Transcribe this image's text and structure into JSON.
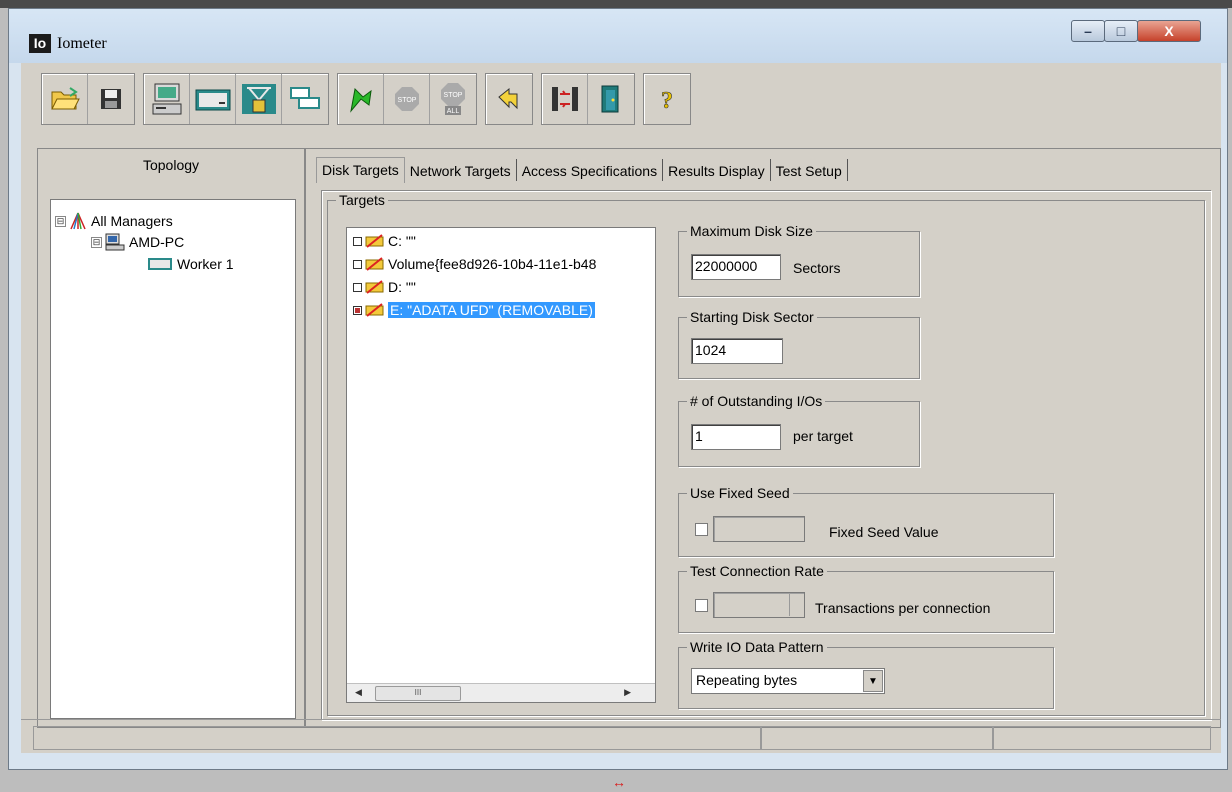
{
  "window": {
    "title": "Iometer",
    "logo_text": "Io",
    "controls": {
      "minimize": "–",
      "maximize": "□",
      "close": "X"
    }
  },
  "toolbar": {
    "groups": [
      [
        "open-icon",
        "save-icon"
      ],
      [
        "display-manager-icon",
        "disk-worker-icon",
        "network-worker-icon",
        "duplicate-worker-icon"
      ],
      [
        "start-icon",
        "stop-icon",
        "stop-all-icon"
      ],
      [
        "reset-workers-icon"
      ],
      [
        "disconnect-icon",
        "exit-icon"
      ],
      [
        "help-icon"
      ]
    ],
    "stop_label": "STOP",
    "stop_all_label": "STOP",
    "all_label": "ALL",
    "help_label": "?"
  },
  "topology": {
    "title": "Topology",
    "items": [
      {
        "label": "All Managers",
        "expander": "⊟"
      },
      {
        "label": "AMD-PC",
        "expander": "⊟"
      },
      {
        "label": "Worker 1"
      }
    ]
  },
  "tabs": [
    {
      "label": "Disk Targets"
    },
    {
      "label": "Network Targets"
    },
    {
      "label": "Access Specifications"
    },
    {
      "label": "Results Display"
    },
    {
      "label": "Test Setup"
    }
  ],
  "targets": {
    "group_label": "Targets",
    "items": [
      {
        "label": "C: \"\"",
        "checked": false
      },
      {
        "label": "Volume{fee8d926-10b4-11e1-b48",
        "checked": false
      },
      {
        "label": "D: \"\"",
        "checked": false
      },
      {
        "label": "E: \"ADATA UFD\" (REMOVABLE)",
        "checked": true
      }
    ],
    "scroll_grip": "III"
  },
  "max_disk_size": {
    "label": "Maximum Disk Size",
    "value": "22000000",
    "unit": "Sectors"
  },
  "starting_sector": {
    "label": "Starting Disk Sector",
    "value": "1024"
  },
  "outstanding_ios": {
    "label": "# of Outstanding I/Os",
    "value": "1",
    "unit": "per target"
  },
  "fixed_seed": {
    "label": "Use Fixed Seed",
    "value_label": "Fixed Seed Value",
    "value": ""
  },
  "connection_rate": {
    "label": "Test Connection Rate",
    "value_label": "Transactions per connection",
    "value": ""
  },
  "write_pattern": {
    "label": "Write IO Data Pattern",
    "selected": "Repeating bytes"
  },
  "resize_arrow": "↔"
}
